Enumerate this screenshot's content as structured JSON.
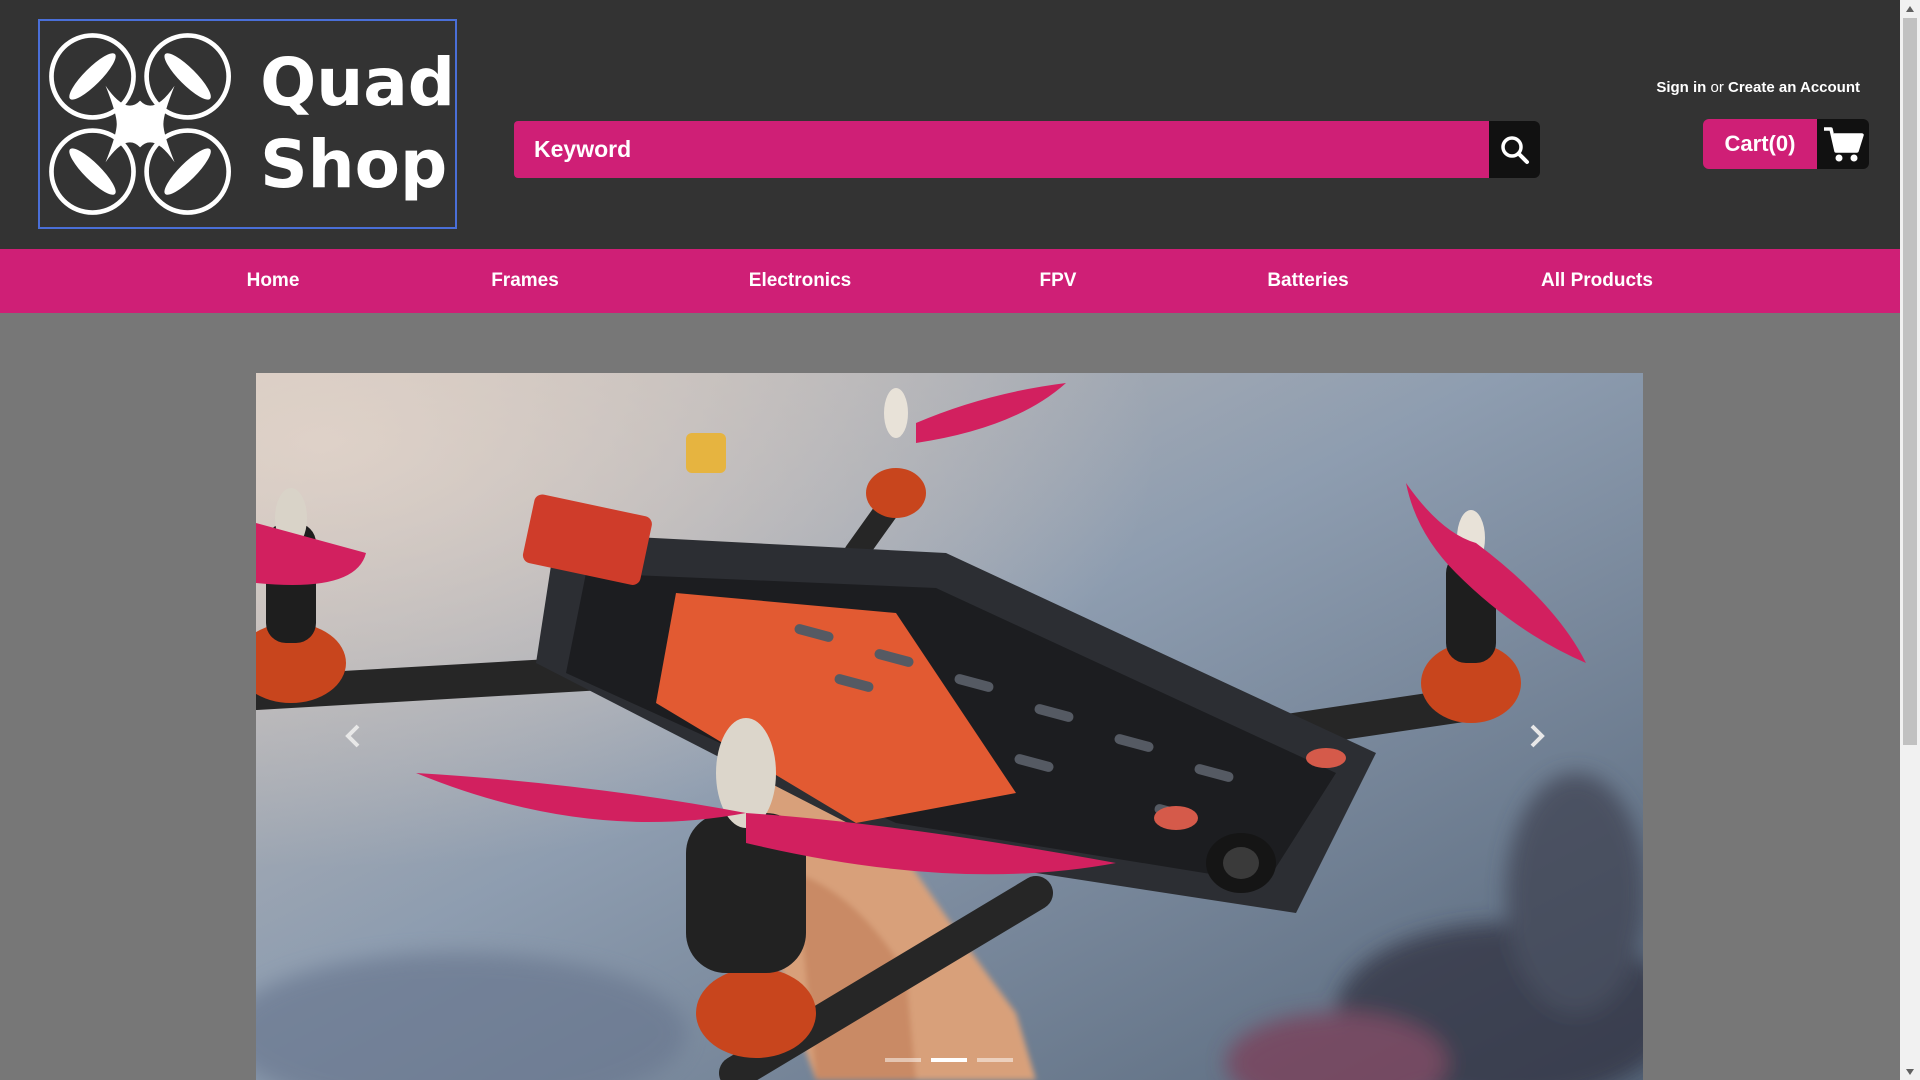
{
  "brand": {
    "line1": "Quad",
    "line2": "Shop",
    "logo_icon": "quadcopter-icon"
  },
  "search": {
    "placeholder": "Keyword",
    "button_icon": "search-icon"
  },
  "account": {
    "sign_in": "Sign in",
    "separator": "or",
    "create": "Create an Account"
  },
  "cart": {
    "label": "Cart(0)",
    "icon": "cart-icon"
  },
  "nav": {
    "items": [
      {
        "label": "Home"
      },
      {
        "label": "Frames"
      },
      {
        "label": "Electronics"
      },
      {
        "label": "FPV"
      },
      {
        "label": "Batteries"
      },
      {
        "label": "All Products"
      }
    ]
  },
  "carousel": {
    "image": "quadcopter-drone-held-in-hand-photo",
    "prev_icon": "chevron-left-icon",
    "next_icon": "chevron-right-icon",
    "slide_count": 3,
    "active_slide": 2
  },
  "colors": {
    "accent": "#cf1f76",
    "header_bg": "#333333",
    "page_bg": "#777777"
  }
}
